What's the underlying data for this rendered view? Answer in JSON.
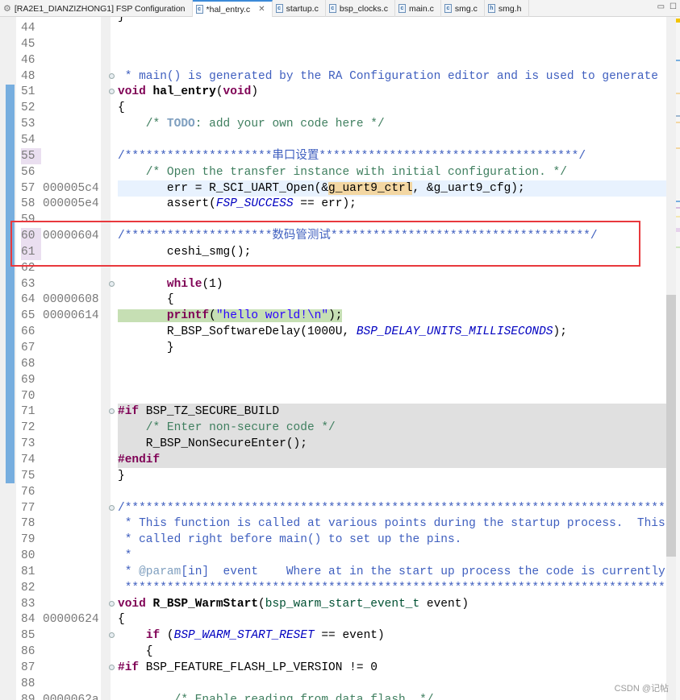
{
  "tabs": [
    {
      "label": "[RA2E1_DIANZIZHONG1] FSP Configuration",
      "icon": "gear-icon",
      "active": false
    },
    {
      "label": "*hal_entry.c",
      "icon": "c-file-icon",
      "active": true,
      "closable": true
    },
    {
      "label": "startup.c",
      "icon": "c-file-icon",
      "active": false
    },
    {
      "label": "bsp_clocks.c",
      "icon": "c-file-icon",
      "active": false
    },
    {
      "label": "main.c",
      "icon": "c-file-icon",
      "active": false
    },
    {
      "label": "smg.c",
      "icon": "c-file-icon",
      "active": false
    },
    {
      "label": "smg.h",
      "icon": "h-file-icon",
      "active": false
    }
  ],
  "window_controls": {
    "minimize": "▭",
    "maximize": "☐"
  },
  "partial_top_line": "}",
  "lines": [
    {
      "n": "44",
      "s": []
    },
    {
      "n": "45",
      "s": []
    },
    {
      "n": "46",
      "s": []
    },
    {
      "n": "48",
      "fold": true,
      "s": [
        [
          "doc",
          " * main() is generated by the RA Configuration editor and is used to generate threads if an RTOS is used."
        ]
      ]
    },
    {
      "n": "51",
      "fold": true,
      "s": [
        [
          "kw",
          "void"
        ],
        [
          "fnb",
          " hal_entry"
        ],
        [
          "",
          "("
        ],
        [
          "kw",
          "void"
        ],
        [
          "",
          ")"
        ]
      ]
    },
    {
      "n": "52",
      "s": [
        [
          "",
          "{"
        ]
      ]
    },
    {
      "n": "53",
      "s": [
        [
          "cm",
          "    /* "
        ],
        [
          "todo",
          "TODO"
        ],
        [
          "cm",
          ": add your own code here */"
        ]
      ]
    },
    {
      "n": "54",
      "s": []
    },
    {
      "n": "55",
      "mark": true,
      "s": [
        [
          "doc",
          "/*********************串口设置*************************************/"
        ]
      ]
    },
    {
      "n": "56",
      "s": [
        [
          "cm",
          "    /* Open the transfer instance with initial configuration. */"
        ]
      ]
    },
    {
      "n": "57",
      "addr": "000005c4",
      "cur": true,
      "s": [
        [
          "",
          "       err = R_SCI_UART_Open(&"
        ],
        [
          "occ",
          "g_uart9_ctrl"
        ],
        [
          "",
          ", &g_uart9_cfg);"
        ]
      ]
    },
    {
      "n": "58",
      "addr": "000005e4",
      "s": [
        [
          "",
          "       assert("
        ],
        [
          "mac",
          "FSP_SUCCESS"
        ],
        [
          "",
          " == err);"
        ]
      ]
    },
    {
      "n": "59",
      "s": []
    },
    {
      "n": "60",
      "addr": "00000604",
      "mark": true,
      "s": [
        [
          "doc",
          "/*********************数码管测试*************************************/"
        ]
      ]
    },
    {
      "n": "61",
      "mark": true,
      "s": [
        [
          "",
          "       ceshi_smg();"
        ]
      ]
    },
    {
      "n": "62",
      "s": []
    },
    {
      "n": "63",
      "fold": true,
      "s": [
        [
          "",
          "       "
        ],
        [
          "kw",
          "while"
        ],
        [
          "",
          "(1)"
        ]
      ]
    },
    {
      "n": "64",
      "addr": "00000608",
      "s": [
        [
          "",
          "       {"
        ]
      ]
    },
    {
      "n": "65",
      "addr": "00000614",
      "dbg": true,
      "s": [
        [
          "hl",
          "       "
        ],
        [
          "hl kw",
          "printf"
        ],
        [
          "hl",
          "("
        ],
        [
          "hl str",
          "\"hello world!\\n\""
        ],
        [
          "hl",
          ");"
        ]
      ]
    },
    {
      "n": "66",
      "s": [
        [
          "",
          "       R_BSP_SoftwareDelay(1000U, "
        ],
        [
          "mac",
          "BSP_DELAY_UNITS_MILLISECONDS"
        ],
        [
          "",
          ");"
        ]
      ]
    },
    {
      "n": "67",
      "s": [
        [
          "",
          "       }"
        ]
      ]
    },
    {
      "n": "68",
      "s": []
    },
    {
      "n": "69",
      "s": []
    },
    {
      "n": "70",
      "s": []
    },
    {
      "n": "71",
      "fold": true,
      "pp": true,
      "s": [
        [
          "kw",
          "#if"
        ],
        [
          "",
          " BSP_TZ_SECURE_BUILD"
        ]
      ]
    },
    {
      "n": "72",
      "pp": true,
      "s": [
        [
          "cm",
          "    /* Enter non-secure code */"
        ]
      ]
    },
    {
      "n": "73",
      "pp": true,
      "s": [
        [
          "",
          "    R_BSP_NonSecureEnter();"
        ]
      ]
    },
    {
      "n": "74",
      "pp": true,
      "s": [
        [
          "kw",
          "#endif"
        ]
      ]
    },
    {
      "n": "75",
      "s": [
        [
          "",
          "}"
        ]
      ]
    },
    {
      "n": "76",
      "s": []
    },
    {
      "n": "77",
      "fold": true,
      "s": [
        [
          "doc",
          "/*******************************************************************************************"
        ]
      ]
    },
    {
      "n": "78",
      "s": [
        [
          "doc",
          " * This function is called at various points during the startup process.  This"
        ]
      ]
    },
    {
      "n": "79",
      "s": [
        [
          "doc",
          " * called right before main() to set up the pins."
        ]
      ]
    },
    {
      "n": "80",
      "s": [
        [
          "doc",
          " *"
        ]
      ]
    },
    {
      "n": "81",
      "s": [
        [
          "doc",
          " * "
        ],
        [
          "tag",
          "@param"
        ],
        [
          "doc",
          "[in]  event    Where at in the start up process the code is currently"
        ]
      ]
    },
    {
      "n": "82",
      "s": [
        [
          "doc",
          " *******************************************************************************************"
        ]
      ]
    },
    {
      "n": "83",
      "fold": true,
      "s": [
        [
          "kw",
          "void"
        ],
        [
          "fnb",
          " R_BSP_WarmStart"
        ],
        [
          "",
          "("
        ],
        [
          "ty",
          "bsp_warm_start_event_t"
        ],
        [
          "",
          " event)"
        ]
      ]
    },
    {
      "n": "84",
      "addr": "00000624",
      "s": [
        [
          "",
          "{"
        ]
      ]
    },
    {
      "n": "85",
      "fold": true,
      "s": [
        [
          "",
          "    "
        ],
        [
          "kw",
          "if"
        ],
        [
          "",
          " ("
        ],
        [
          "mac",
          "BSP_WARM_START_RESET"
        ],
        [
          "",
          " == event)"
        ]
      ]
    },
    {
      "n": "86",
      "s": [
        [
          "",
          "    {"
        ]
      ]
    },
    {
      "n": "87",
      "fold": true,
      "s": [
        [
          "kw",
          "#if"
        ],
        [
          "",
          " BSP_FEATURE_FLASH_LP_VERSION != 0"
        ]
      ]
    },
    {
      "n": "88",
      "s": []
    },
    {
      "n": "89",
      "addr": "0000062a",
      "s": [
        [
          "cm",
          "        /* Enable reading from data flash. */"
        ]
      ]
    }
  ],
  "colors": {
    "keyword": "#7f0055",
    "comment": "#3f7f5f",
    "doc_comment": "#3f5fbf",
    "macro": "#0000c0",
    "string": "#2a00ff",
    "annotation_box": "#e8393d",
    "current_line": "#e8f2fe",
    "debug_line": "#c6dfb4",
    "occurrence": "#f3d7a3",
    "inactive_preprocessor": "#e0e0e0"
  },
  "watermark": "CSDN @记帖"
}
